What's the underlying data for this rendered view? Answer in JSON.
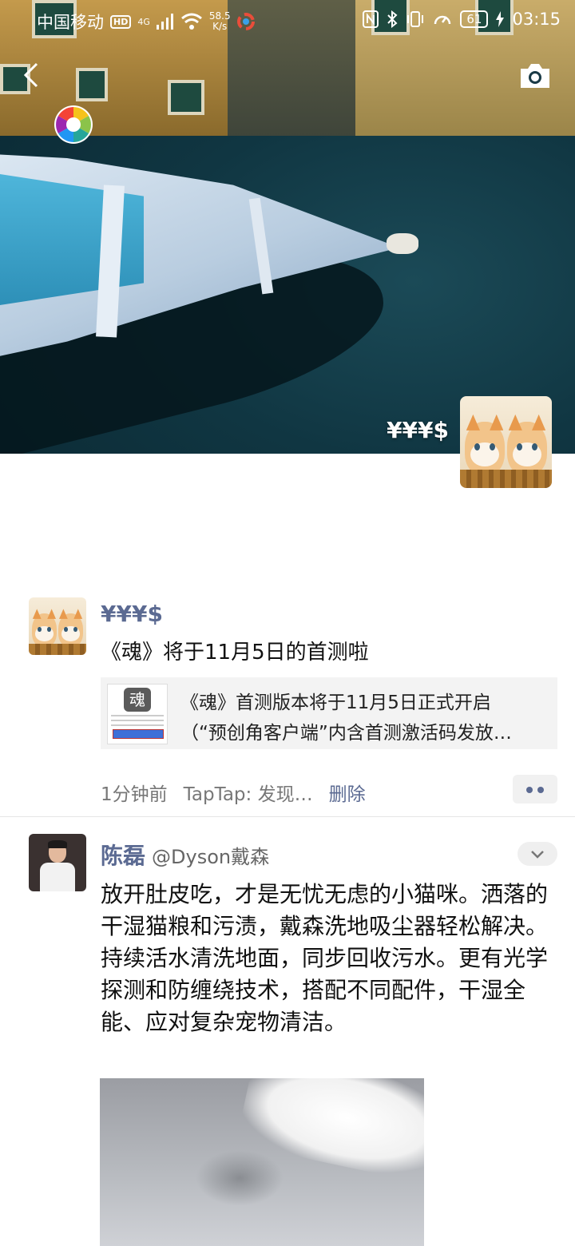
{
  "status_bar": {
    "carrier": "中国移动",
    "hd_badge": "HD",
    "signal": "4G",
    "speed_value": "58.5",
    "speed_unit": "K/s",
    "battery": "61",
    "time": "03:15"
  },
  "cover": {
    "user_name": "¥¥¥$"
  },
  "post1": {
    "author": "¥¥¥$",
    "text": "《魂》将于11月5日的首测啦",
    "link_title": "《魂》首测版本将于11月5日正式开启",
    "link_subtitle": "（“预创角客户端”内含首测激活码发放…",
    "time": "1分钟前",
    "source": "TapTap: 发现…",
    "delete_label": "删除"
  },
  "post2": {
    "author": "陈磊",
    "handle": "@Dyson戴森",
    "paragraphs": [
      "放开肚皮吃，才是无忧无虑的小猫咪。洒落的干湿猫粮和污渍，戴森洗地吸尘器轻松解决。",
      "持续活水清洗地面，同步回收污水。更有光学探测和防缠绕技术，搭配不同配件，干湿全能、应对复杂宠物清洁。"
    ]
  },
  "colors": {
    "name_link": "#5b6a92",
    "meta_text": "#777777",
    "link_card_bg": "#f3f3f3"
  }
}
